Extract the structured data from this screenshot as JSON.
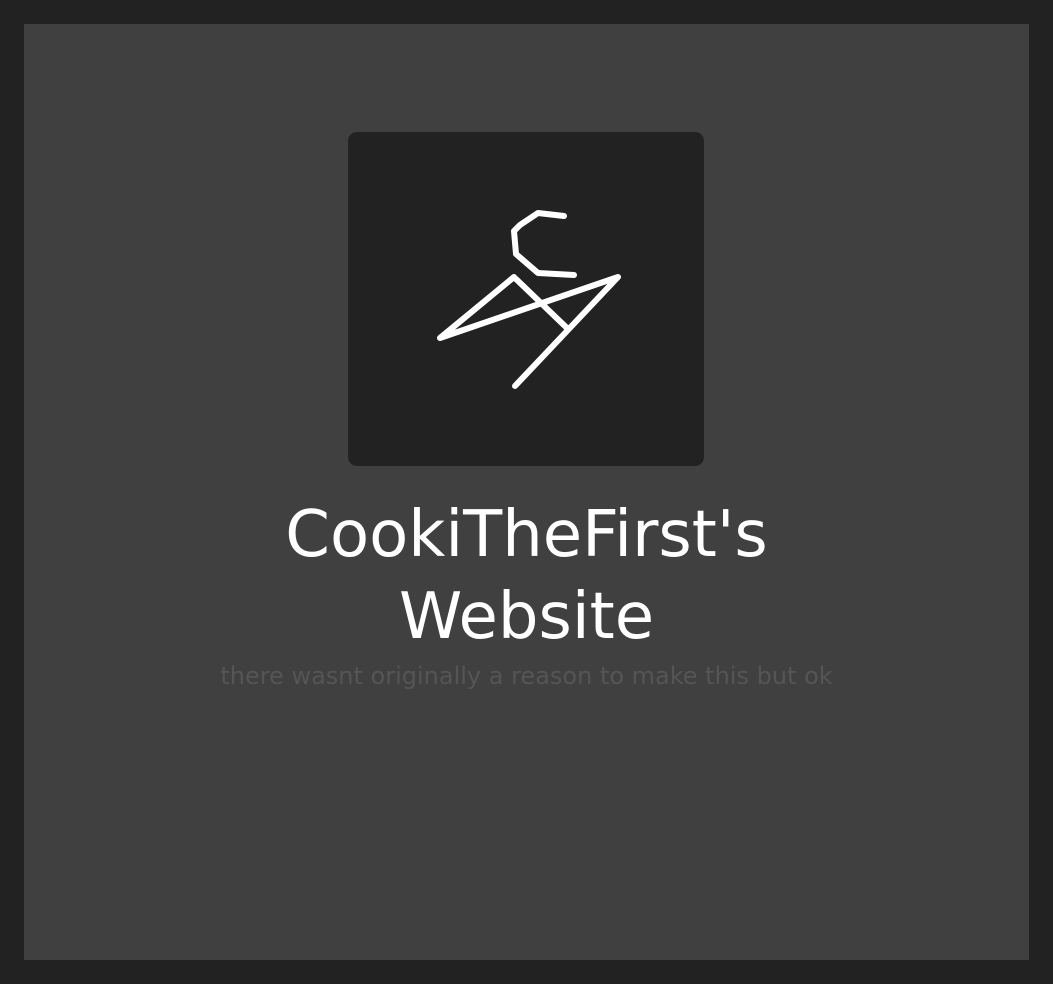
{
  "page": {
    "background_color": "#222222",
    "panel_color": "#404040"
  },
  "logo": {
    "icon": "signature-logo-icon",
    "box_color": "#222222",
    "stroke_color": "#ffffff"
  },
  "header": {
    "title_line1": "CookiTheFirst's",
    "title_line2": "Website",
    "tagline": "there wasnt originally a reason to make this but ok"
  }
}
